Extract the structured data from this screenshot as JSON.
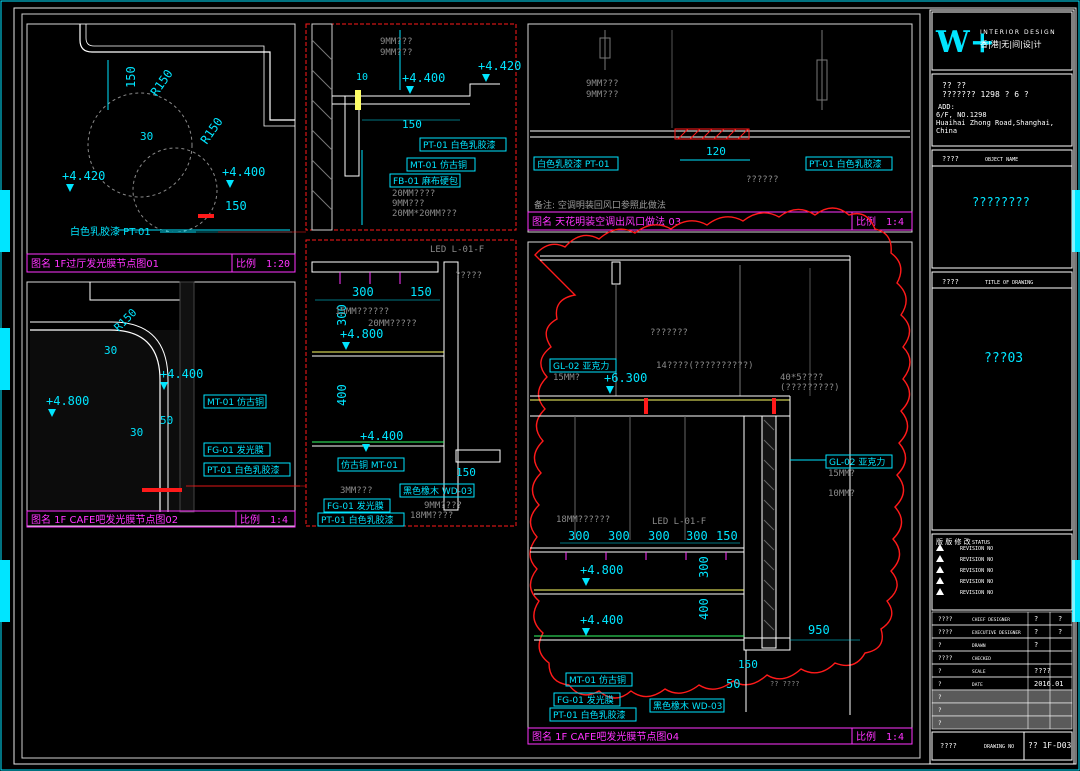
{
  "colors": {
    "background": "#000000",
    "cyan": "#00e5ff",
    "magenta": "#ff33ff",
    "red": "#ff1a1a",
    "white": "#ffffff",
    "yellow": "#ffff66",
    "grey": "#9a9a9a",
    "green": "#33ff66"
  },
  "title_block": {
    "logo_mark": "W+",
    "logo_en": "INTERIOR DESIGN",
    "logo_cn": "香|港|无|间|设|计",
    "addr_line1": "?? ??",
    "addr_line2": "??????? 1298 ? 6 ?",
    "addr_label": "ADD:",
    "addr_line3": "6/F, NO.1298",
    "addr_line4": "Huaihai Zhong Road,Shanghai,",
    "addr_line5": "China",
    "project_label_cn": "????",
    "project_label_en": "OBJECT NAME",
    "project_value": "????????",
    "drawing_label_cn": "????",
    "drawing_label_en": "TITLE OF DRAWING",
    "drawing_value": "???03",
    "rev_header_cn": "版 版 修 改",
    "rev_header_en": "STATUS",
    "revisions": [
      "REVISION NO",
      "REVISION NO",
      "REVISION NO",
      "REVISION NO",
      "REVISION NO"
    ],
    "rows": [
      {
        "cn": "????",
        "en": "CHIEF DESIGNER",
        "v1": "?",
        "v2": "?"
      },
      {
        "cn": "????",
        "en": "EXECUTIVE DESIGNER",
        "v1": "?",
        "v2": "?"
      },
      {
        "cn": "?",
        "en": "DRAWN",
        "v1": "?",
        "v2": ""
      },
      {
        "cn": "????",
        "en": "CHECKED",
        "v1": "",
        "v2": ""
      },
      {
        "cn": "?",
        "en": "SCALE",
        "v1": "????",
        "v2": ""
      },
      {
        "cn": "?",
        "en": "DATE",
        "v1": "2016.01",
        "v2": ""
      },
      {
        "cn": "?",
        "en": "",
        "v1": "",
        "v2": ""
      },
      {
        "cn": "?",
        "en": "",
        "v1": "",
        "v2": ""
      },
      {
        "cn": "?",
        "en": "",
        "v1": "",
        "v2": ""
      }
    ],
    "drawing_no_cn": "????",
    "drawing_no_en": "DRAWING NO",
    "drawing_no_value": "?? 1F-D03"
  },
  "panel1": {
    "title": "图名 1F过厅发光膜节点图01",
    "scale_label": "比例",
    "scale_value": "1:20",
    "dims": [
      "150",
      "R150",
      "R150",
      "30",
      "150"
    ],
    "levels": [
      "+4.420",
      "+4.400"
    ],
    "tag": "白色乳胶漆 PT-01"
  },
  "panel2": {
    "notes": [
      "9MM???",
      "9MM???",
      "20MM????",
      "9MM???",
      "20MM*20MM???"
    ],
    "levels": [
      "+4.400",
      "+4.420"
    ],
    "dims": [
      "10",
      "150"
    ],
    "tags": [
      "PT-01 白色乳胶漆",
      "MT-01 仿古铜",
      "FB-01 麻布硬包"
    ]
  },
  "panel3": {
    "notes": [
      "9MM???",
      "9MM???",
      "??????"
    ],
    "dim": "120",
    "tags": [
      "白色乳胶漆 PT-01",
      "PT-01 白色乳胶漆"
    ],
    "remark": "备注: 空调明装回风口参照此做法",
    "title": "图名 天花明装空调出风口做法 03",
    "scale_label": "比例",
    "scale_value": "1:4"
  },
  "panel4": {
    "title": "图名 1F CAFE吧发光膜节点图02",
    "scale_label": "比例",
    "scale_value": "1:4",
    "dims": [
      "R150",
      "30",
      "50",
      "30"
    ],
    "levels": [
      "+4.800",
      "+4.400"
    ],
    "tags": [
      "MT-01 仿古铜",
      "FG-01 发光膜",
      "PT-01 白色乳胶漆"
    ]
  },
  "panel5": {
    "notes": [
      "LED L-01-F",
      "?????",
      "15MM??????",
      "20MM?????",
      "3MM???",
      "9MM????",
      "18MM????"
    ],
    "dims": [
      "300",
      "150",
      "300",
      "400",
      "150"
    ],
    "levels": [
      "+4.800",
      "+4.400"
    ],
    "tags": [
      "仿古铜 MT-01",
      "FG-01 发光膜",
      "PT-01 白色乳胶漆",
      "黑色橡木 WD-03"
    ]
  },
  "panel6": {
    "notes": [
      "???????",
      "14????(??????????)",
      "40*5????",
      "(?????????)",
      "15MM?",
      "10MM?",
      "15MM?",
      "18MM??????",
      "LED L-01-F",
      "?? ????"
    ],
    "levels": [
      "+6.300",
      "+4.800",
      "+4.400"
    ],
    "dims": [
      "300",
      "300",
      "300",
      "300",
      "150",
      "300",
      "400",
      "950",
      "150",
      "50"
    ],
    "tags": [
      "GL-02 亚克力",
      "GL-02 亚克力",
      "MT-01 仿古铜",
      "FG-01 发光膜",
      "PT-01 白色乳胶漆",
      "黑色橡木 WD-03"
    ],
    "title": "图名 1F CAFE吧发光膜节点图04",
    "scale_label": "比例",
    "scale_value": "1:4"
  }
}
